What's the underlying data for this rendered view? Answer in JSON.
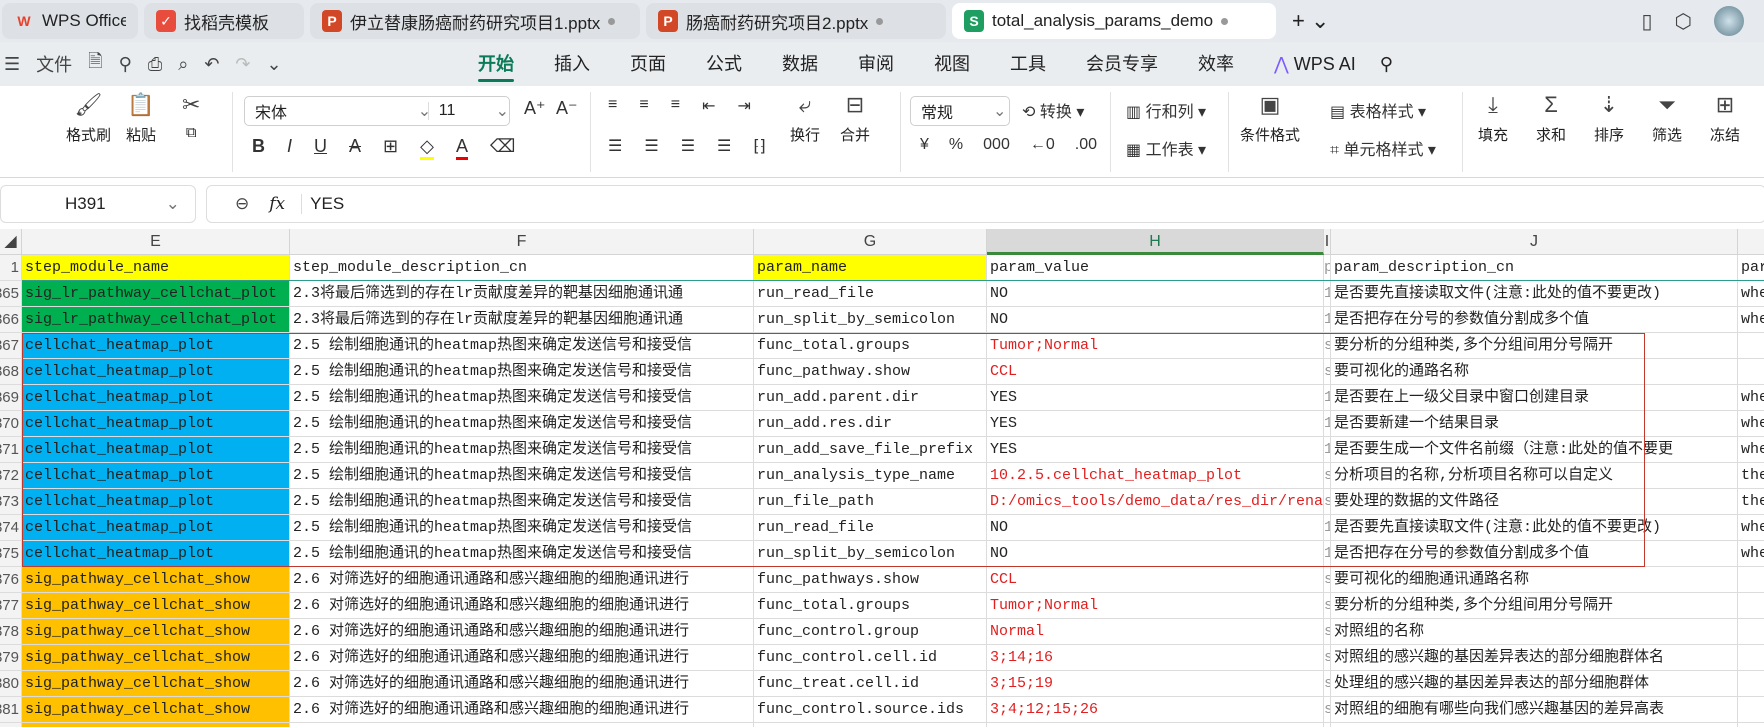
{
  "tabs": [
    {
      "label": "WPS Office",
      "icon": "wps-logo-icon",
      "color": "#e8412c"
    },
    {
      "label": "找稻壳模板",
      "icon": "docer-icon",
      "color": "#e84c3d"
    },
    {
      "label": "伊立替康肠癌耐药研究项目1.pptx",
      "icon": "ppt-icon",
      "color": "#d24726"
    },
    {
      "label": "肠癌耐药研究项目2.pptx",
      "icon": "ppt-icon",
      "color": "#d24726"
    },
    {
      "label": "total_analysis_params_demo",
      "icon": "sheet-icon",
      "color": "#1e9e60"
    }
  ],
  "tab_icon_letters": {
    "ppt": "P",
    "sheet": "S"
  },
  "menu": {
    "file": "文件",
    "items": [
      "开始",
      "插入",
      "页面",
      "公式",
      "数据",
      "审阅",
      "视图",
      "工具",
      "会员专享",
      "效率"
    ],
    "active": "开始",
    "ai": "WPS AI"
  },
  "ribbon": {
    "format_painter": "格式刷",
    "paste": "粘贴",
    "font_name": "宋体",
    "font_size": "11",
    "wrap": "换行",
    "merge": "合并",
    "number_format": "常规",
    "convert": "转换",
    "rows_cols": "行和列",
    "worksheet": "工作表",
    "cond_format": "条件格式",
    "table_style": "表格样式",
    "cell_style": "单元格样式",
    "fill": "填充",
    "sum": "求和",
    "sort": "排序",
    "filter": "筛选",
    "freeze": "冻结"
  },
  "formula_bar": {
    "name_box": "H391",
    "fx": "fx",
    "value": "YES"
  },
  "columns": [
    "E",
    "F",
    "G",
    "H",
    "I",
    "J",
    ""
  ],
  "selected_column": "H",
  "colors": {
    "yellow": "#ffff00",
    "green": "#00b050",
    "blue": "#00b0f0",
    "orange": "#ffc000",
    "red_text": "#e02020",
    "accent": "#0b7a57"
  },
  "rows": [
    {
      "n": "1",
      "E": "step_module_name",
      "F": "step_module_description_cn",
      "G": "param_name",
      "H": "param_value",
      "I": "p",
      "J": "param_description_cn",
      "K": "par",
      "fill": "yellow"
    },
    {
      "n": "365",
      "E": "sig_lr_pathway_cellchat_plot",
      "F": "2.3将最后筛选到的存在lr贡献度差异的靶基因细胞通讯通",
      "G": "run_read_file",
      "H": "NO",
      "I": "1",
      "J": "是否要先直接读取文件(注意:此处的值不要更改)",
      "K": "whe",
      "fill": "green"
    },
    {
      "n": "366",
      "E": "sig_lr_pathway_cellchat_plot",
      "F": "2.3将最后筛选到的存在lr贡献度差异的靶基因细胞通讯通",
      "G": "run_split_by_semicolon",
      "H": "NO",
      "I": "1",
      "J": "是否把存在分号的参数值分割成多个值",
      "K": "whe",
      "fill": "green"
    },
    {
      "n": "367",
      "E": "cellchat_heatmap_plot",
      "F": "2.5 绘制细胞通讯的heatmap热图来确定发送信号和接受信",
      "G": "func_total.groups",
      "H": "Tumor;Normal",
      "red": true,
      "I": "s",
      "J": "要分析的分组种类,多个分组间用分号隔开",
      "K": "",
      "fill": "blue"
    },
    {
      "n": "368",
      "E": "cellchat_heatmap_plot",
      "F": "2.5 绘制细胞通讯的heatmap热图来确定发送信号和接受信",
      "G": "func_pathway.show",
      "H": "CCL",
      "red": true,
      "I": "s",
      "J": "要可视化的通路名称",
      "K": "",
      "fill": "blue"
    },
    {
      "n": "369",
      "E": "cellchat_heatmap_plot",
      "F": "2.5 绘制细胞通讯的heatmap热图来确定发送信号和接受信",
      "G": "run_add.parent.dir",
      "H": "YES",
      "I": "1",
      "J": "是否要在上一级父目录中窗口创建目录",
      "K": "whe",
      "fill": "blue"
    },
    {
      "n": "370",
      "E": "cellchat_heatmap_plot",
      "F": "2.5 绘制细胞通讯的heatmap热图来确定发送信号和接受信",
      "G": "run_add.res.dir",
      "H": "YES",
      "I": "1",
      "J": "是否要新建一个结果目录",
      "K": "whe",
      "fill": "blue"
    },
    {
      "n": "371",
      "E": "cellchat_heatmap_plot",
      "F": "2.5 绘制细胞通讯的heatmap热图来确定发送信号和接受信",
      "G": "run_add_save_file_prefix",
      "H": "YES",
      "I": "1",
      "J": "是否要生成一个文件名前缀（注意:此处的值不要更",
      "K": "whe",
      "fill": "blue"
    },
    {
      "n": "372",
      "E": "cellchat_heatmap_plot",
      "F": "2.5 绘制细胞通讯的heatmap热图来确定发送信号和接受信",
      "G": "run_analysis_type_name",
      "H": "10.2.5.cellchat_heatmap_plot",
      "red": true,
      "I": "s",
      "J": "分析项目的名称,分析项目名称可以自定义",
      "K": "the",
      "fill": "blue"
    },
    {
      "n": "373",
      "E": "cellchat_heatmap_plot",
      "F": "2.5 绘制细胞通讯的heatmap热图来确定发送信号和接受信",
      "G": "run_file_path",
      "H": "D:/omics_tools/demo_data/res_dir/rena",
      "red": true,
      "I": "s",
      "J": "要处理的数据的文件路径",
      "K": "the",
      "fill": "blue"
    },
    {
      "n": "374",
      "E": "cellchat_heatmap_plot",
      "F": "2.5 绘制细胞通讯的heatmap热图来确定发送信号和接受信",
      "G": "run_read_file",
      "H": "NO",
      "I": "1",
      "J": "是否要先直接读取文件(注意:此处的值不要更改)",
      "K": "whe",
      "fill": "blue"
    },
    {
      "n": "375",
      "E": "cellchat_heatmap_plot",
      "F": "2.5 绘制细胞通讯的heatmap热图来确定发送信号和接受信",
      "G": "run_split_by_semicolon",
      "H": "NO",
      "I": "1",
      "J": "是否把存在分号的参数值分割成多个值",
      "K": "whe",
      "fill": "blue"
    },
    {
      "n": "376",
      "E": "sig_pathway_cellchat_show",
      "F": "2.6 对筛选好的细胞通讯通路和感兴趣细胞的细胞通讯进行",
      "G": "func_pathways.show",
      "H": "CCL",
      "red": true,
      "I": "s",
      "J": "要可视化的细胞通讯通路名称",
      "K": "",
      "fill": "orange"
    },
    {
      "n": "377",
      "E": "sig_pathway_cellchat_show",
      "F": "2.6 对筛选好的细胞通讯通路和感兴趣细胞的细胞通讯进行",
      "G": "func_total.groups",
      "H": "Tumor;Normal",
      "red": true,
      "I": "s",
      "J": "要分析的分组种类,多个分组间用分号隔开",
      "K": "",
      "fill": "orange"
    },
    {
      "n": "378",
      "E": "sig_pathway_cellchat_show",
      "F": "2.6 对筛选好的细胞通讯通路和感兴趣细胞的细胞通讯进行",
      "G": "func_control.group",
      "H": "Normal",
      "red": true,
      "I": "s",
      "J": "对照组的名称",
      "K": "",
      "fill": "orange"
    },
    {
      "n": "379",
      "E": "sig_pathway_cellchat_show",
      "F": "2.6 对筛选好的细胞通讯通路和感兴趣细胞的细胞通讯进行",
      "G": "func_control.cell.id",
      "H": "3;14;16",
      "red": true,
      "I": "s",
      "J": "对照组的感兴趣的基因差异表达的部分细胞群体名",
      "K": "",
      "fill": "orange"
    },
    {
      "n": "380",
      "E": "sig_pathway_cellchat_show",
      "F": "2.6 对筛选好的细胞通讯通路和感兴趣细胞的细胞通讯进行",
      "G": "func_treat.cell.id",
      "H": "3;15;19",
      "red": true,
      "I": "s",
      "J": "处理组的感兴趣的基因差异表达的部分细胞群体",
      "K": "",
      "fill": "orange"
    },
    {
      "n": "381",
      "E": "sig_pathway_cellchat_show",
      "F": "2.6 对筛选好的细胞通讯通路和感兴趣细胞的细胞通讯进行",
      "G": "func_control.source.ids",
      "H": "3;4;12;15;26",
      "red": true,
      "I": "s",
      "J": "对照组的细胞有哪些向我们感兴趣基因的差异高表",
      "K": "",
      "fill": "orange"
    }
  ]
}
